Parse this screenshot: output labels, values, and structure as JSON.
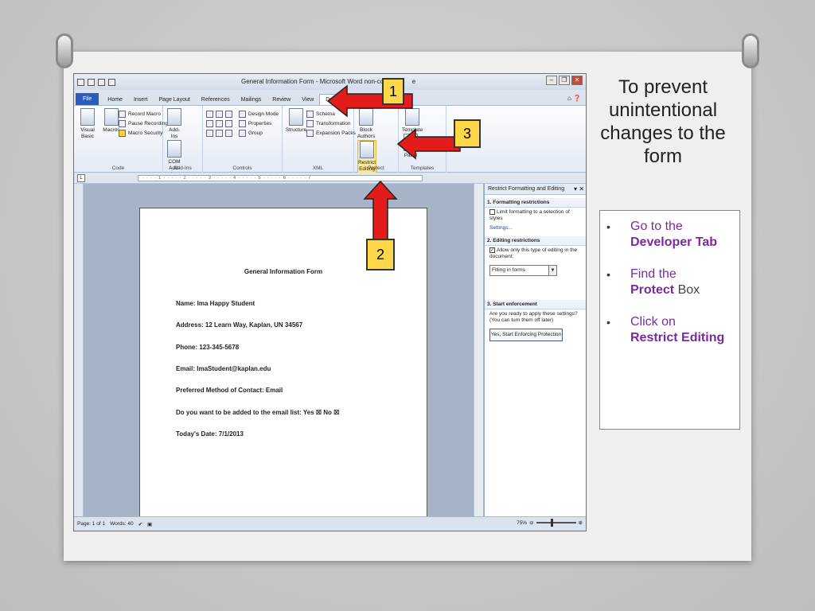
{
  "word": {
    "title": "General Information Form - Microsoft Word non-com",
    "title_suffix": "e",
    "tabs": [
      "File",
      "Home",
      "Insert",
      "Page Layout",
      "References",
      "Mailings",
      "Review",
      "View",
      "Developer"
    ],
    "ribbon": {
      "code": {
        "label": "Code",
        "visual_basic": "Visual Basic",
        "macros": "Macros",
        "record_macro": "Record Macro",
        "pause_recording": "Pause Recording",
        "macro_security": "Macro Security"
      },
      "addins": {
        "label": "Add-Ins",
        "addins": "Add-Ins",
        "com_addins": "COM Add-Ins"
      },
      "controls": {
        "label": "Controls",
        "design_mode": "Design Mode",
        "properties": "Properties",
        "group": "Group"
      },
      "xml": {
        "label": "XML",
        "structure": "Structure",
        "schema": "Schema",
        "transformation": "Transformation",
        "expansion_packs": "Expansion Packs"
      },
      "protect": {
        "label": "Protect",
        "block_authors": "Block Authors",
        "restrict_editing": "Restrict Editing"
      },
      "templates": {
        "label": "Templates",
        "document_template": "Template",
        "panel": "Panel"
      }
    },
    "document": {
      "title": "General Information Form",
      "lines": [
        "Name: Ima Happy Student",
        "Address: 12 Learn Way, Kaplan, UN 34567",
        "Phone: 123-345-5678",
        "Email: ImaStudent@kaplan.edu",
        "Preferred Method of Contact: Email",
        "Do you want to be added to the email list: Yes ☒  No ☒",
        "Today's Date: 7/1/2013"
      ]
    },
    "pane": {
      "title": "Restrict Formatting and Editing",
      "sec1": "1. Formatting restrictions",
      "sec1_opt": "Limit formatting to a selection of styles",
      "settings": "Settings...",
      "sec2": "2. Editing restrictions",
      "sec2_opt": "Allow only this type of editing in the document:",
      "edit_type": "Filling in forms",
      "sec3": "3. Start enforcement",
      "sec3_text": "Are you ready to apply these settings? (You can turn them off later)",
      "enforce_button": "Yes, Start Enforcing Protection"
    },
    "status": {
      "page": "Page: 1 of 1",
      "words": "Words: 40",
      "zoom": "75%"
    }
  },
  "callouts": [
    "1",
    "2",
    "3"
  ],
  "slide": {
    "heading": "To prevent unintentional changes to the form",
    "bullets": [
      {
        "pre": "Go to the ",
        "bold": "Developer Tab",
        "post": ""
      },
      {
        "pre": "Find the ",
        "bold": "Protect",
        "post": " Box"
      },
      {
        "pre": "Click on ",
        "bold": "Restrict Editing",
        "post": ""
      }
    ]
  },
  "colors": {
    "arrow_red": "#e31b1b",
    "callout_yellow": "#ffd84a",
    "bullet_purple": "#7a2aa0",
    "file_tab_blue": "#2a5bbd"
  }
}
